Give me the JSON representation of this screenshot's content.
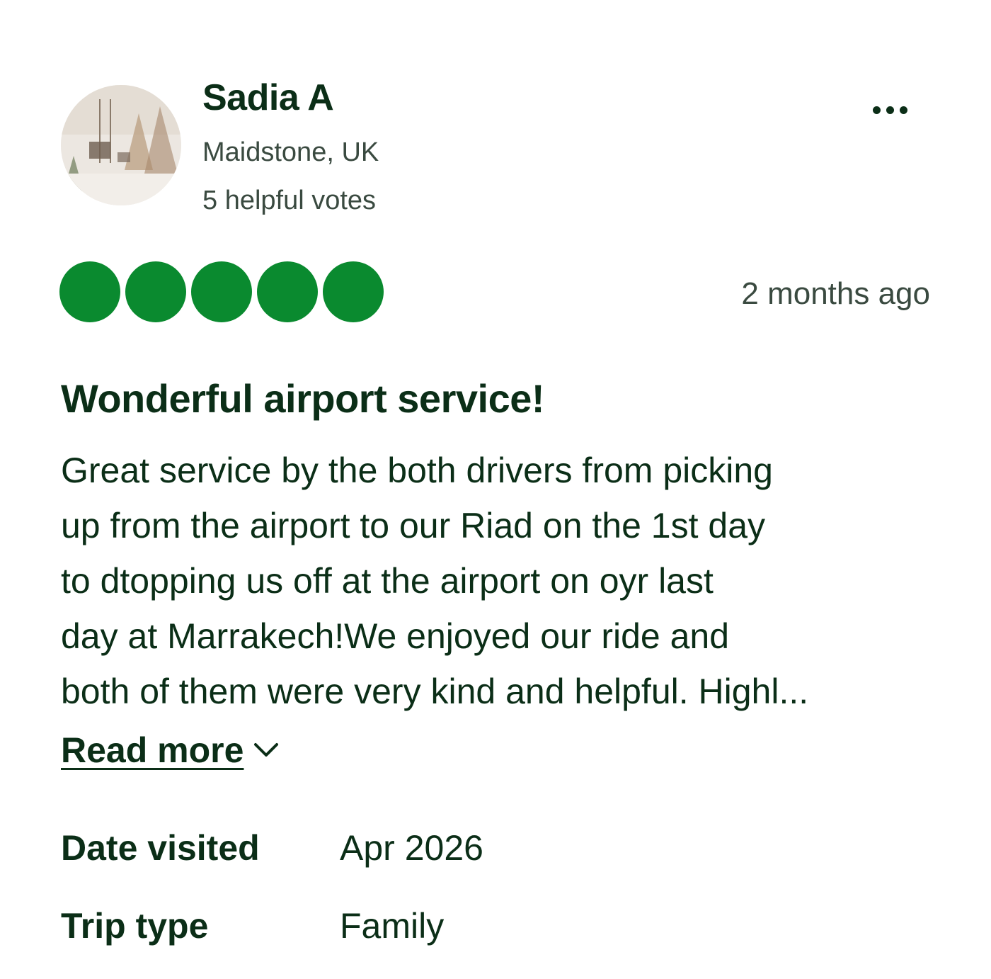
{
  "reviewer": {
    "name": "Sadia A",
    "location": "Maidstone, UK",
    "helpful_votes": "5 helpful votes",
    "avatar_icon": "avatar-photo"
  },
  "menu": {
    "icon": "more-options-icon"
  },
  "review": {
    "rating": 5,
    "rating_max": 5,
    "rating_color": "#0a8a2f",
    "date": "2 months ago",
    "title": "Wonderful airport service!",
    "body_lines": [
      "Great service by the both drivers from picking",
      "up from the airport to our Riad on the 1st day",
      "to dtopping us off at the airport on oyr last",
      "day at Marrakech!We enjoyed our ride and",
      "both of them were very kind and helpful. Highl..."
    ],
    "read_more": "Read more"
  },
  "details": {
    "date_visited_label": "Date visited",
    "date_visited_value": "Apr 2026",
    "trip_type_label": "Trip type",
    "trip_type_value": "Family"
  }
}
